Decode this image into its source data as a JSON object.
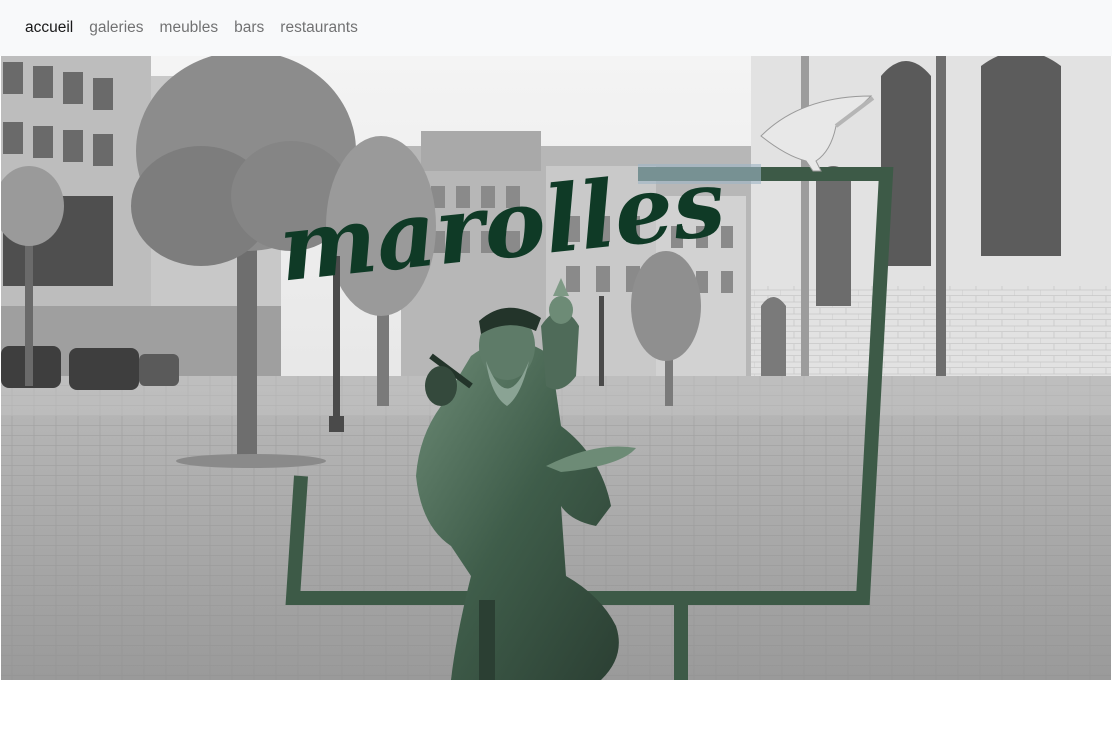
{
  "nav": {
    "items": [
      {
        "label": "accueil",
        "active": true
      },
      {
        "label": "galeries",
        "active": false
      },
      {
        "label": "meubles",
        "active": false
      },
      {
        "label": "bars",
        "active": false
      },
      {
        "label": "restaurants",
        "active": false
      }
    ]
  },
  "hero": {
    "logo_text": "marolles",
    "logo_color": "#0f3a26",
    "statue_color": "#4c6b58"
  }
}
